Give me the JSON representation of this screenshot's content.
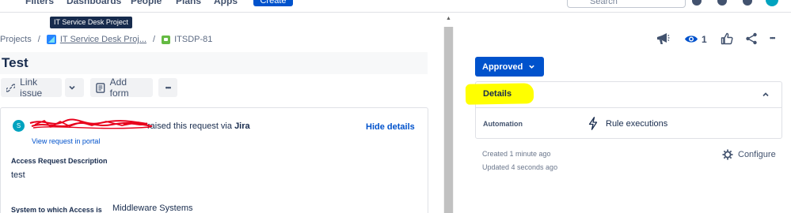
{
  "topnav": {
    "items": [
      "Filters",
      "Dashboards",
      "People",
      "Plans",
      "Apps"
    ],
    "create_label": "Create",
    "search_placeholder": "Search"
  },
  "tooltip": {
    "text": "IT Service Desk Project"
  },
  "breadcrumb": {
    "projects": "Projects",
    "separator": "/",
    "project": "IT Service Desk Proj...",
    "issue_key": "ITSDP-81"
  },
  "issue": {
    "title": "Test"
  },
  "toolbar": {
    "link_issue": "Link issue",
    "add_form": "Add form",
    "more": "•••"
  },
  "request": {
    "avatar_initial": "S",
    "raised_text": "raised this request via",
    "channel": "Jira",
    "view_portal": "View request in portal",
    "hide_details": "Hide details",
    "fields": [
      {
        "label": "Access Request Description",
        "value": "test"
      },
      {
        "label": "System to which Access is",
        "value": "Middleware Systems"
      }
    ]
  },
  "header_actions": {
    "watch_count": "1",
    "more": "•••"
  },
  "status": {
    "label": "Approved"
  },
  "details": {
    "title": "Details",
    "automation_label": "Automation",
    "rule_executions": "Rule executions"
  },
  "meta": {
    "created": "Created 1 minute ago",
    "updated": "Updated 4 seconds ago",
    "configure": "Configure"
  },
  "colors": {
    "brand_blue": "#0052cc",
    "highlight": "#ffff00",
    "redaction": "#e8001c",
    "avatar": "#00a3bf",
    "issue_type": "#65ba43"
  }
}
